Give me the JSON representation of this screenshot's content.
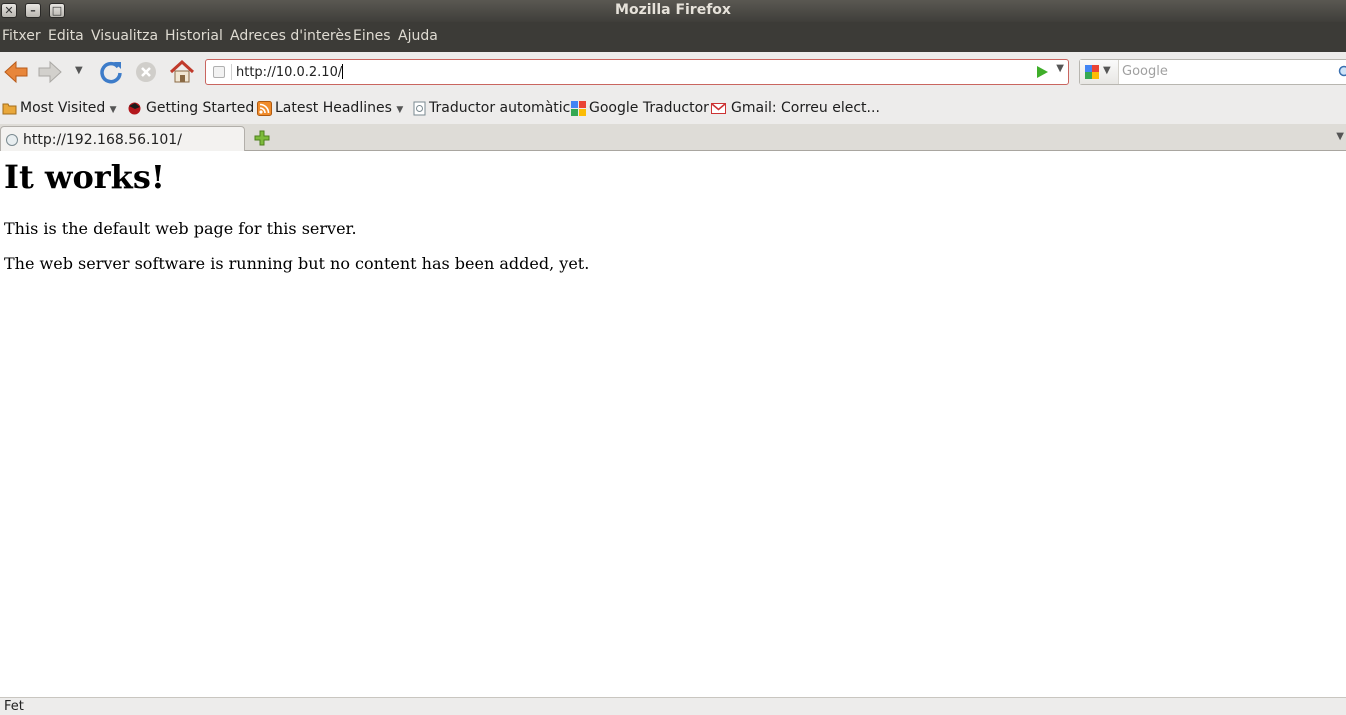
{
  "window": {
    "title": "Mozilla Firefox"
  },
  "menu": {
    "items": [
      "Fitxer",
      "Edita",
      "Visualitza",
      "Historial",
      "Adreces d'interès",
      "Eines",
      "Ajuda"
    ]
  },
  "navigation": {
    "url": "http://10.0.2.10/",
    "search_placeholder": "Google"
  },
  "bookmarks": {
    "items": [
      "Most Visited",
      "Getting Started",
      "Latest Headlines",
      "Traductor automàtic",
      "Google Traductor",
      "Gmail: Correu elect..."
    ]
  },
  "tabs": [
    {
      "label": "http://192.168.56.101/"
    }
  ],
  "page": {
    "heading": "It works!",
    "paragraphs": [
      "This is the default web page for this server.",
      "The web server software is running but no content has been added, yet."
    ]
  },
  "status": {
    "text": "Fet"
  },
  "colors": {
    "menubar": "#3c3b37",
    "titlebar": "#4a4945",
    "toolbar": "#edeceb",
    "urlbar_border": "#c9655f"
  }
}
